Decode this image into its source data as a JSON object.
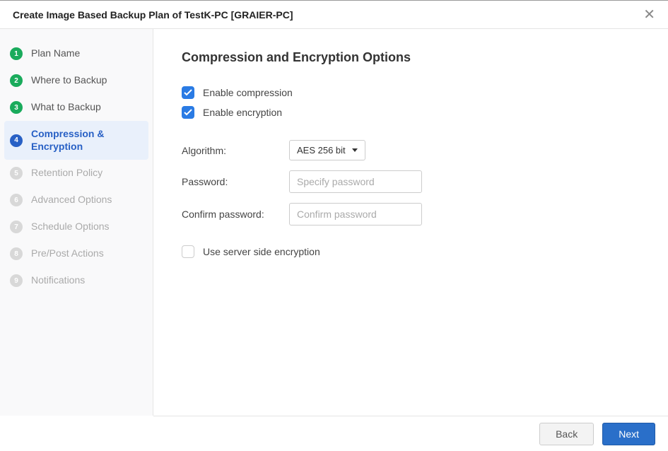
{
  "header": {
    "title": "Create Image Based Backup Plan of TestK-PC [GRAIER-PC]"
  },
  "sidebar": {
    "steps": [
      {
        "num": "1",
        "label": "Plan Name",
        "state": "done"
      },
      {
        "num": "2",
        "label": "Where to Backup",
        "state": "done"
      },
      {
        "num": "3",
        "label": "What to Backup",
        "state": "done"
      },
      {
        "num": "4",
        "label": "Compression & Encryption",
        "state": "active"
      },
      {
        "num": "5",
        "label": "Retention Policy",
        "state": "upcoming"
      },
      {
        "num": "6",
        "label": "Advanced Options",
        "state": "upcoming"
      },
      {
        "num": "7",
        "label": "Schedule Options",
        "state": "upcoming"
      },
      {
        "num": "8",
        "label": "Pre/Post Actions",
        "state": "upcoming"
      },
      {
        "num": "9",
        "label": "Notifications",
        "state": "upcoming"
      }
    ]
  },
  "main": {
    "heading": "Compression and Encryption Options",
    "enable_compression_label": "Enable compression",
    "enable_compression_checked": true,
    "enable_encryption_label": "Enable encryption",
    "enable_encryption_checked": true,
    "algorithm_label": "Algorithm:",
    "algorithm_value": "AES 256 bit",
    "password_label": "Password:",
    "password_placeholder": "Specify password",
    "password_value": "",
    "confirm_label": "Confirm password:",
    "confirm_placeholder": "Confirm password",
    "confirm_value": "",
    "server_side_label": "Use server side encryption",
    "server_side_checked": false
  },
  "footer": {
    "back_label": "Back",
    "next_label": "Next"
  }
}
